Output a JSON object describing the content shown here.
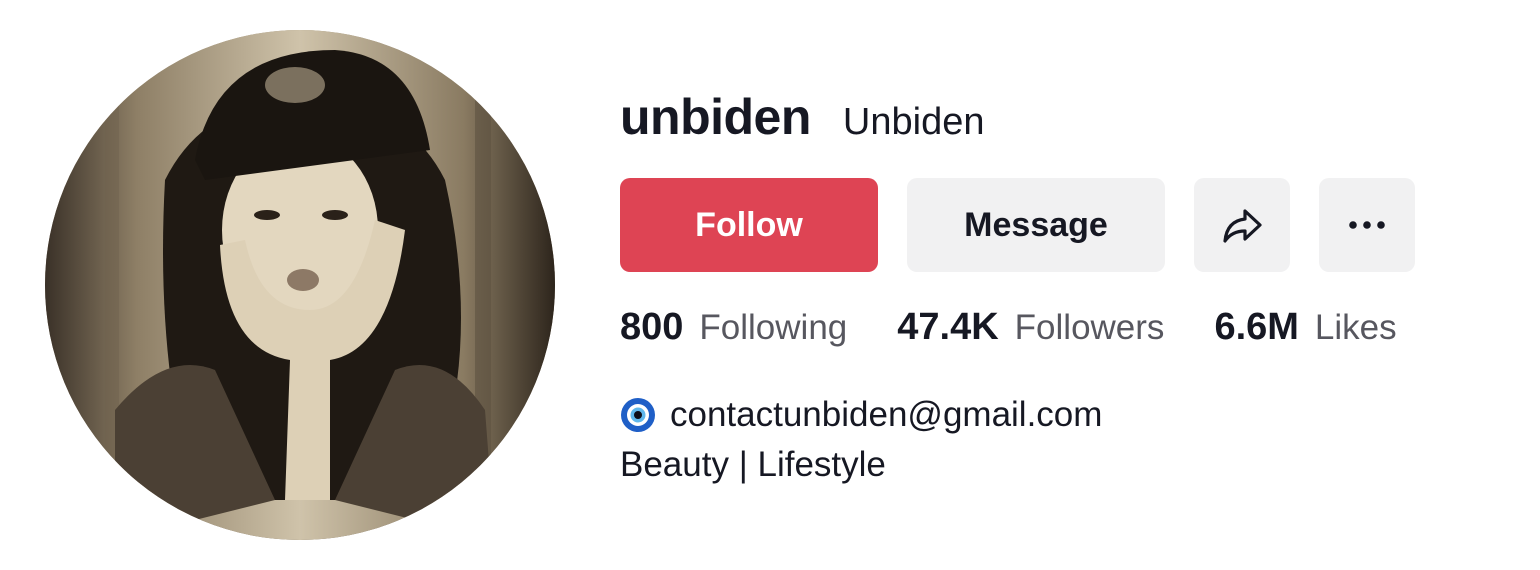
{
  "profile": {
    "username": "unbiden",
    "nickname": "Unbiden"
  },
  "actions": {
    "follow_label": "Follow",
    "message_label": "Message",
    "share_icon": "share-arrow-icon",
    "more_icon": "more-dots-icon"
  },
  "stats": {
    "following_count": "800",
    "following_label": "Following",
    "followers_count": "47.4K",
    "followers_label": "Followers",
    "likes_count": "6.6M",
    "likes_label": "Likes"
  },
  "bio": {
    "line1_icon": "nazar-eye-icon",
    "email": "contactunbiden@gmail.com",
    "line2": "Beauty | Lifestyle"
  },
  "colors": {
    "follow_bg": "#de4454",
    "secondary_bg": "#f1f1f2",
    "text_primary": "#161823",
    "text_secondary": "#57575f"
  }
}
